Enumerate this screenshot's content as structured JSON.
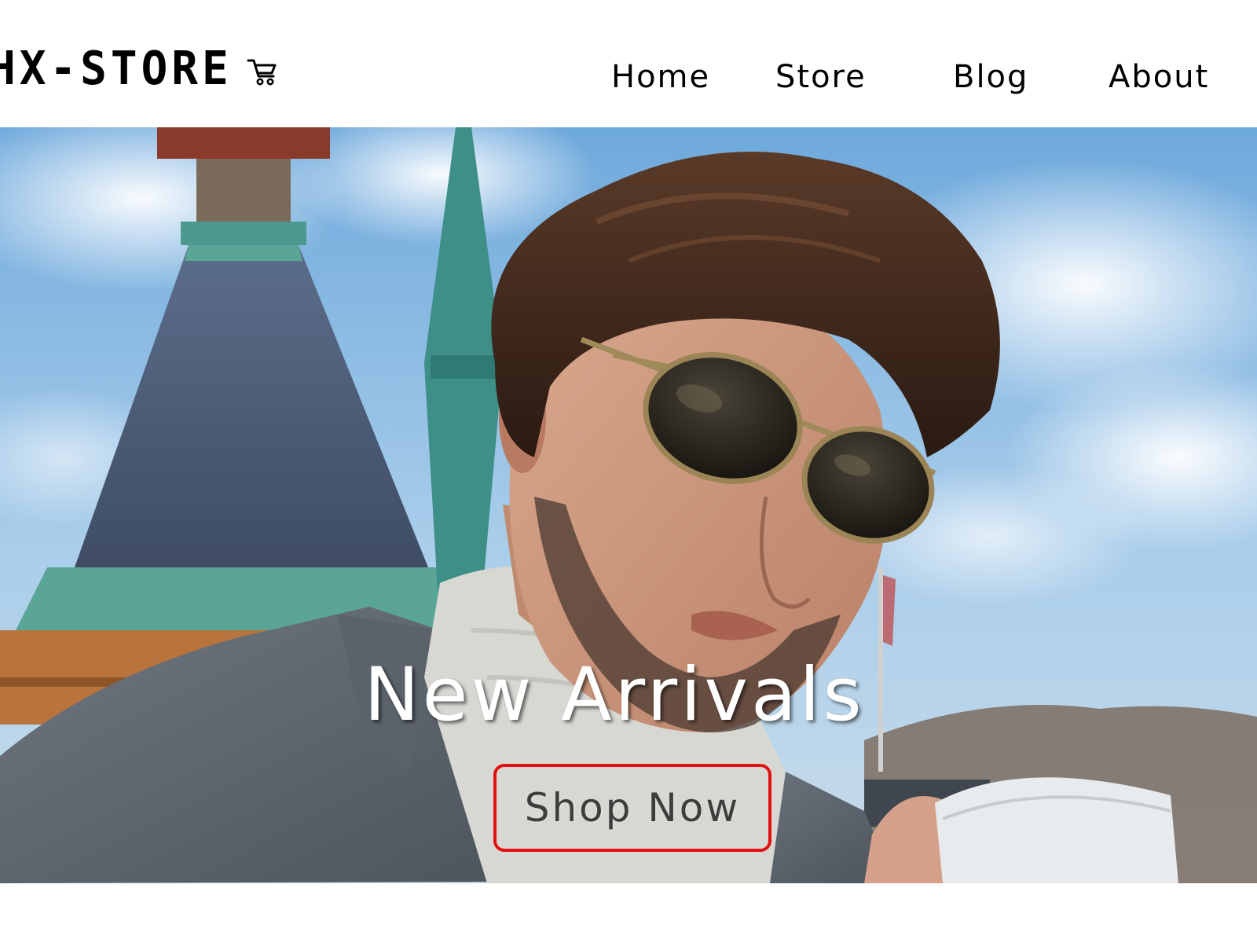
{
  "header": {
    "logo_text": "HX-STORE",
    "logo_icon": "shopping-cart-icon",
    "nav": {
      "home": "Home",
      "store": "Store",
      "blog": "Blog",
      "about": "About"
    }
  },
  "hero": {
    "image_description_icon": "hero-photo",
    "title": "New Arrivals",
    "cta_label": "Shop Now"
  },
  "colors": {
    "cta_border": "#e01010",
    "title_text": "#ffffff",
    "nav_text": "#000000"
  }
}
